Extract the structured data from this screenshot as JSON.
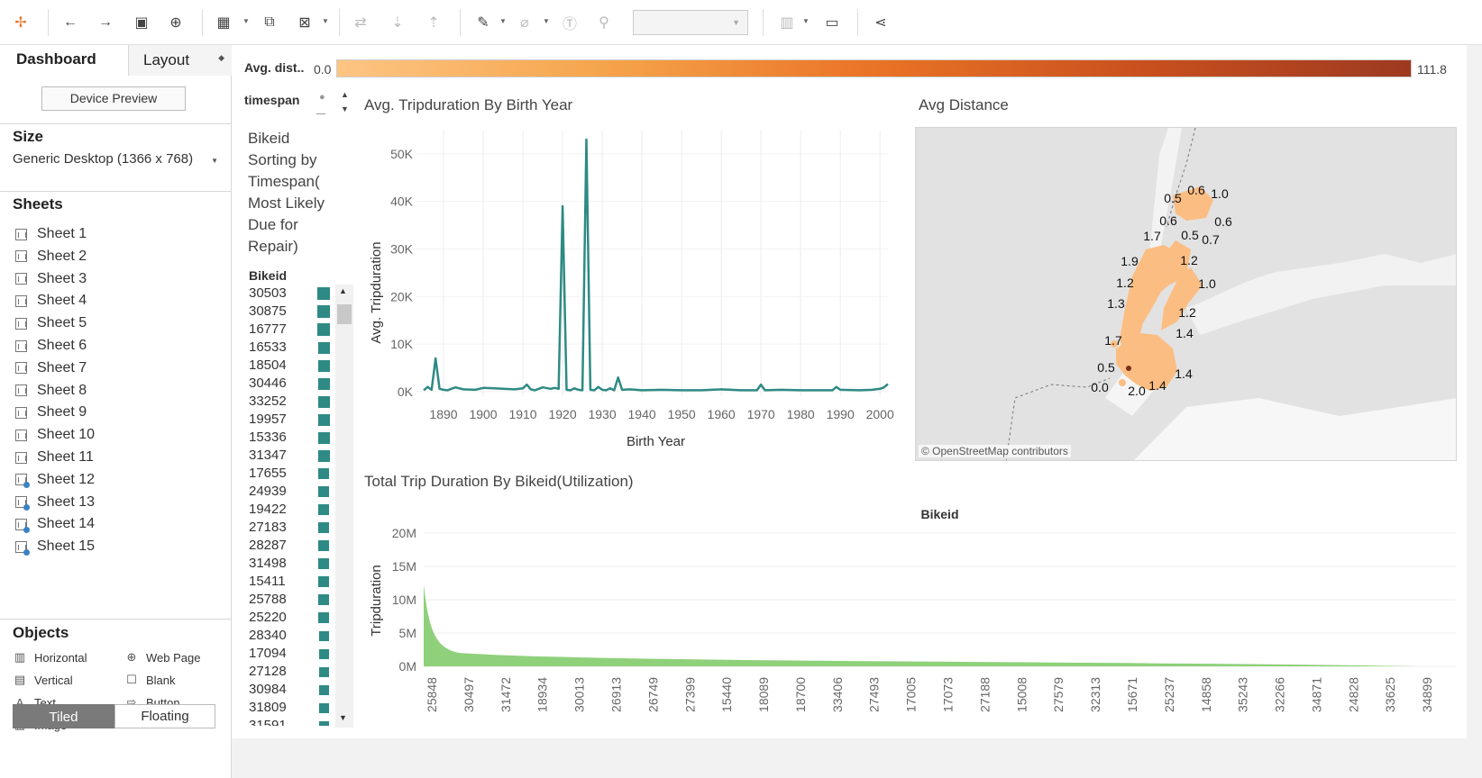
{
  "toolbar": {
    "icons": [
      "tableau-logo-icon",
      "undo-icon",
      "redo-icon",
      "save-icon",
      "add-datasource-icon",
      "new-sheet-icon",
      "duplicate-icon",
      "clear-icon",
      "swap-icon",
      "sort-asc-icon",
      "sort-desc-icon",
      "highlight-icon",
      "group-icon",
      "label-icon",
      "pin-icon",
      "show-me-icon",
      "presentation-icon",
      "share-icon"
    ]
  },
  "left_panel": {
    "tab_dashboard": "Dashboard",
    "tab_layout": "Layout",
    "device_preview": "Device Preview",
    "size_heading": "Size",
    "size_value": "Generic Desktop (1366 x 768)",
    "sheets_heading": "Sheets",
    "sheets": [
      {
        "label": "Sheet 1",
        "dot": false
      },
      {
        "label": "Sheet 2",
        "dot": false
      },
      {
        "label": "Sheet 3",
        "dot": false
      },
      {
        "label": "Sheet 4",
        "dot": false
      },
      {
        "label": "Sheet 5",
        "dot": false
      },
      {
        "label": "Sheet 6",
        "dot": false
      },
      {
        "label": "Sheet 7",
        "dot": false
      },
      {
        "label": "Sheet 8",
        "dot": false
      },
      {
        "label": "Sheet 9",
        "dot": false
      },
      {
        "label": "Sheet 10",
        "dot": false
      },
      {
        "label": "Sheet 11",
        "dot": false
      },
      {
        "label": "Sheet 12",
        "dot": true
      },
      {
        "label": "Sheet 13",
        "dot": true
      },
      {
        "label": "Sheet 14",
        "dot": true
      },
      {
        "label": "Sheet 15",
        "dot": true
      }
    ],
    "objects_heading": "Objects",
    "objects": [
      {
        "label": "Horizontal",
        "icon": "horizontal-icon",
        "glyph": "▥"
      },
      {
        "label": "Web Page",
        "icon": "web-page-icon",
        "glyph": "⊕"
      },
      {
        "label": "Vertical",
        "icon": "vertical-icon",
        "glyph": "▤"
      },
      {
        "label": "Blank",
        "icon": "blank-icon",
        "glyph": "☐"
      },
      {
        "label": "Text",
        "icon": "text-icon",
        "glyph": "A"
      },
      {
        "label": "Button",
        "icon": "button-icon",
        "glyph": "⇨"
      },
      {
        "label": "Image",
        "icon": "image-icon",
        "glyph": "▨"
      }
    ],
    "tiled": "Tiled",
    "floating": "Floating"
  },
  "legend": {
    "title": "Avg. dist..",
    "min": "0.0",
    "max": "111.8"
  },
  "timespan": {
    "label": "timespan"
  },
  "bike_sort": {
    "title_lines": [
      "Bikeid",
      "Sorting by",
      "Timespan(",
      "Most Likely",
      "Due for",
      "Repair)"
    ],
    "column_header": "Bikeid",
    "ids": [
      "30503",
      "30875",
      "16777",
      "16533",
      "18504",
      "30446",
      "33252",
      "19957",
      "15336",
      "31347",
      "17655",
      "24939",
      "19422",
      "27183",
      "28287",
      "31498",
      "15411",
      "25788",
      "25220",
      "28340",
      "17094",
      "27128",
      "30984",
      "31809",
      "31591"
    ],
    "values": [
      1.0,
      1.0,
      0.97,
      0.95,
      0.95,
      0.93,
      0.92,
      0.92,
      0.9,
      0.9,
      0.88,
      0.88,
      0.87,
      0.86,
      0.85,
      0.85,
      0.84,
      0.83,
      0.83,
      0.82,
      0.81,
      0.8,
      0.8,
      0.79,
      0.78
    ],
    "color": "#2e8a84"
  },
  "charts": {
    "line_title": "Avg. Tripduration By Birth Year",
    "map_title": "Avg Distance",
    "map_credit": "© OpenStreetMap contributors",
    "map_labels": [
      "0.5",
      "0.6",
      "1.0",
      "0.6",
      "0.6",
      "0.5",
      "0.7",
      "1.7",
      "1.9",
      "1.2",
      "1.2",
      "1.0",
      "1.3",
      "1.2",
      "1.4",
      "1.7",
      "0.5",
      "1.4",
      "0.0",
      "2.0",
      "1.4"
    ],
    "area_title": "Total Trip Duration By Bikeid(Utilization)"
  },
  "chart_data": [
    {
      "type": "line",
      "title": "Avg. Tripduration By Birth Year",
      "xlabel": "Birth Year",
      "ylabel": "Avg. Tripduration",
      "xlim": [
        1885,
        2002
      ],
      "ylim": [
        0,
        53000
      ],
      "xticks": [
        "1890",
        "1900",
        "1910",
        "1920",
        "1930",
        "1940",
        "1950",
        "1960",
        "1970",
        "1980",
        "1990",
        "2000"
      ],
      "yticks": [
        "0K",
        "10K",
        "20K",
        "30K",
        "40K",
        "50K"
      ],
      "color": "#2e8a84",
      "x": [
        1885,
        1886,
        1887,
        1888,
        1889,
        1890,
        1891,
        1893,
        1895,
        1898,
        1900,
        1903,
        1905,
        1908,
        1910,
        1911,
        1912,
        1913,
        1915,
        1917,
        1918,
        1919,
        1920,
        1921,
        1922,
        1923,
        1924,
        1925,
        1926,
        1927,
        1928,
        1929,
        1930,
        1931,
        1932,
        1933,
        1934,
        1935,
        1937,
        1940,
        1945,
        1950,
        1955,
        1960,
        1965,
        1969,
        1970,
        1971,
        1975,
        1980,
        1985,
        1988,
        1989,
        1990,
        1995,
        1998,
        2000,
        2001,
        2002
      ],
      "y": [
        300,
        1000,
        400,
        7000,
        600,
        400,
        300,
        900,
        500,
        400,
        800,
        700,
        600,
        500,
        700,
        1500,
        500,
        300,
        900,
        600,
        800,
        600,
        39000,
        400,
        300,
        700,
        400,
        300,
        53000,
        400,
        300,
        1000,
        400,
        300,
        700,
        300,
        3000,
        400,
        500,
        300,
        400,
        300,
        300,
        500,
        300,
        300,
        1500,
        300,
        400,
        300,
        300,
        300,
        1000,
        400,
        300,
        400,
        600,
        900,
        1600
      ]
    },
    {
      "type": "area",
      "title": "Total Trip Duration By Bikeid(Utilization)",
      "xlabel": "Bikeid",
      "ylabel": "Tripduration",
      "ylim": [
        0,
        20000000
      ],
      "yticks": [
        "0M",
        "5M",
        "10M",
        "15M",
        "20M"
      ],
      "color": "#8fd07b",
      "categories": [
        "25848",
        "30497",
        "31472",
        "18934",
        "30013",
        "26913",
        "26749",
        "27399",
        "15440",
        "18089",
        "18700",
        "33406",
        "27493",
        "17005",
        "17073",
        "27188",
        "15008",
        "27579",
        "32313",
        "15671",
        "25237",
        "14858",
        "35243",
        "32266",
        "34871",
        "24828",
        "33625",
        "34899"
      ],
      "values": [
        12300000,
        2000000,
        1700000,
        1500000,
        1380000,
        1250000,
        1150000,
        1080000,
        1000000,
        930000,
        880000,
        830000,
        780000,
        740000,
        700000,
        660000,
        620000,
        580000,
        540000,
        500000,
        450000,
        400000,
        350000,
        300000,
        240000,
        170000,
        80000,
        0
      ]
    }
  ]
}
